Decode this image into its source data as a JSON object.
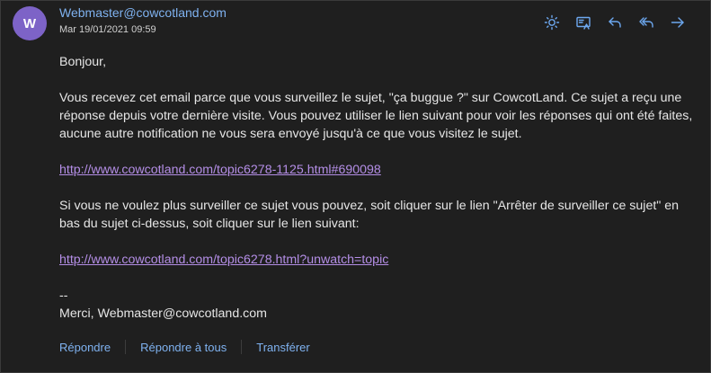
{
  "header": {
    "avatar_initial": "W",
    "sender": "Webmaster@cowcotland.com",
    "date": "Mar 19/01/2021 09:59"
  },
  "icons": {
    "brightness": "sun-icon",
    "immersive_reader": "reader-icon",
    "reply": "reply-icon",
    "reply_all": "reply-all-icon",
    "forward": "forward-icon"
  },
  "body": {
    "greeting": "Bonjour,",
    "paragraph1": "Vous recevez cet email parce que vous surveillez le sujet, \"ça buggue ?\" sur CowcotLand. Ce sujet a reçu une réponse depuis votre dernière visite. Vous pouvez utiliser le lien suivant pour voir les réponses qui ont été faites, aucune autre notification ne vous sera envoyé jusqu'à ce que vous visitez le sujet.",
    "link1": "http://www.cowcotland.com/topic6278-1125.html#690098",
    "paragraph2": "Si vous ne voulez plus surveiller ce sujet vous pouvez, soit cliquer sur le lien \"Arrêter de surveiller ce sujet\" en bas du sujet ci-dessus, soit cliquer sur le lien suivant:",
    "link2": "http://www.cowcotland.com/topic6278.html?unwatch=topic",
    "signature_dash": "--",
    "signature": "Merci, Webmaster@cowcotland.com"
  },
  "footer": {
    "reply": "Répondre",
    "reply_all": "Répondre à tous",
    "forward": "Transférer"
  },
  "colors": {
    "background": "#1f1f1f",
    "accent": "#7fb2f0",
    "link": "#b48ee6",
    "avatar": "#7d63c7"
  }
}
